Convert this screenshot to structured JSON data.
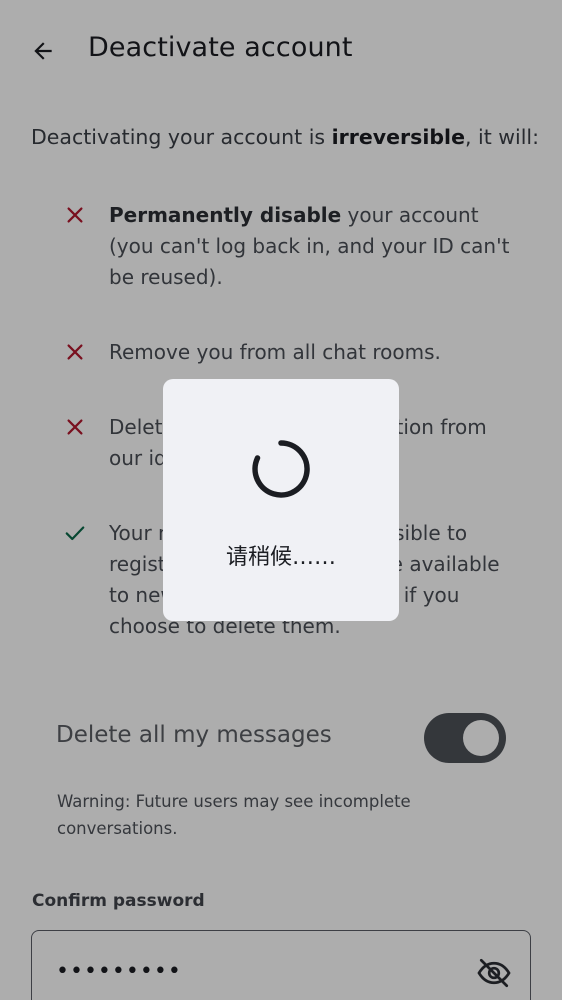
{
  "header": {
    "title": "Deactivate account",
    "back_icon": "arrow-left-icon"
  },
  "intro": {
    "before": "Deactivating your account is ",
    "emphasis": "irreversible",
    "after": ", it will:"
  },
  "consequences": [
    {
      "icon": "close-icon",
      "bold": "Permanently disable",
      "rest": " your account (you can't log back in, and your ID can't be reused).",
      "color": "#b3182f"
    },
    {
      "icon": "close-icon",
      "bold": "",
      "rest": "Remove you from all chat rooms.",
      "color": "#b3182f"
    },
    {
      "icon": "close-icon",
      "bold": "",
      "rest": "Delete your account information from our identity server.",
      "color": "#b3182f"
    },
    {
      "icon": "check-icon",
      "bold": "",
      "rest": "Your messages will still be visible to registered users but won't be available to new or unregistered users if you choose to delete them.",
      "color": "#0b6b4a"
    }
  ],
  "delete_messages": {
    "label": "Delete all my messages",
    "enabled": true
  },
  "warning": "Warning: Future users may see incomplete conversations.",
  "password": {
    "label": "Confirm password",
    "value": "•••••••••",
    "toggle_icon": "eye-off-icon"
  },
  "loading_dialog": {
    "text": "请稍候……"
  },
  "colors": {
    "destructive": "#b3182f",
    "success": "#0b6b4a",
    "dialog_bg": "#f0f1f5"
  }
}
